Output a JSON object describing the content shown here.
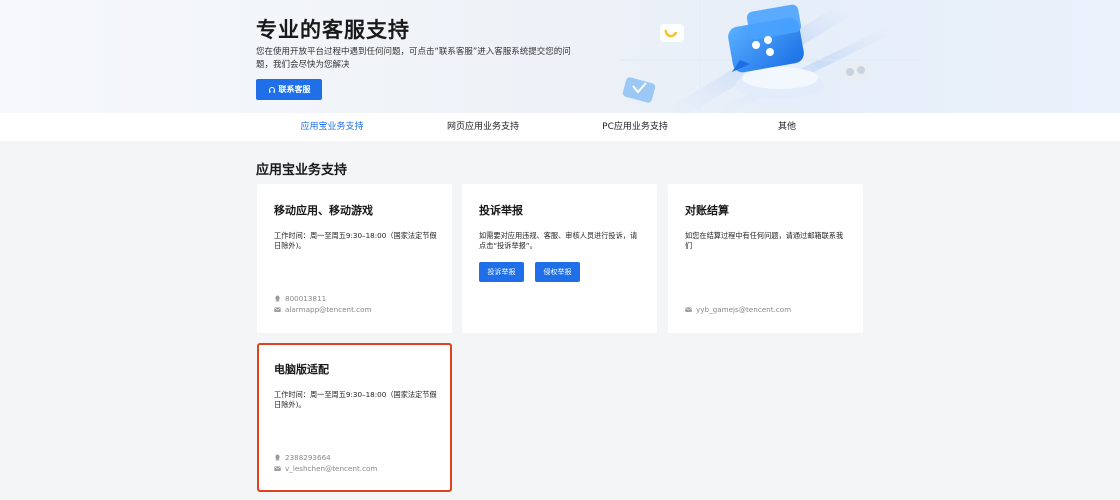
{
  "hero": {
    "title": "专业的客服支持",
    "description": "您在使用开放平台过程中遇到任何问题，可点击“联系客服”进入客服系统提交您的问题，我们会尽快为您解决",
    "contact_button": "联系客服",
    "colors": {
      "accent": "#1f6fe8"
    }
  },
  "tabs": [
    {
      "label": "应用宝业务支持",
      "active": true
    },
    {
      "label": "网页应用业务支持",
      "active": false
    },
    {
      "label": "PC应用业务支持",
      "active": false
    },
    {
      "label": "其他",
      "active": false
    }
  ],
  "section": {
    "title": "应用宝业务支持"
  },
  "cards": [
    {
      "title": "移动应用、移动游戏",
      "description": "工作时间：周一至周五9:30–18:00（国家法定节假日除外)。",
      "qq": "800013811",
      "email": "alarmapp@tencent.com"
    },
    {
      "title": "投诉举报",
      "description": "如需要对应用违规、客服、审核人员进行投诉，请点击“投诉举报”。",
      "buttons": [
        "投诉举报",
        "侵权举报"
      ]
    },
    {
      "title": "对账结算",
      "description": "如您在结算过程中有任何问题，请通过邮箱联系我们",
      "email": "yyb_gamejs@tencent.com"
    },
    {
      "title": "电脑版适配",
      "description": "工作时间：周一至周五9:30–18:00（国家法定节假日除外)。",
      "qq": "2388293664",
      "email": "v_leshchen@tencent.com",
      "highlight_color": "#e0411f"
    }
  ]
}
